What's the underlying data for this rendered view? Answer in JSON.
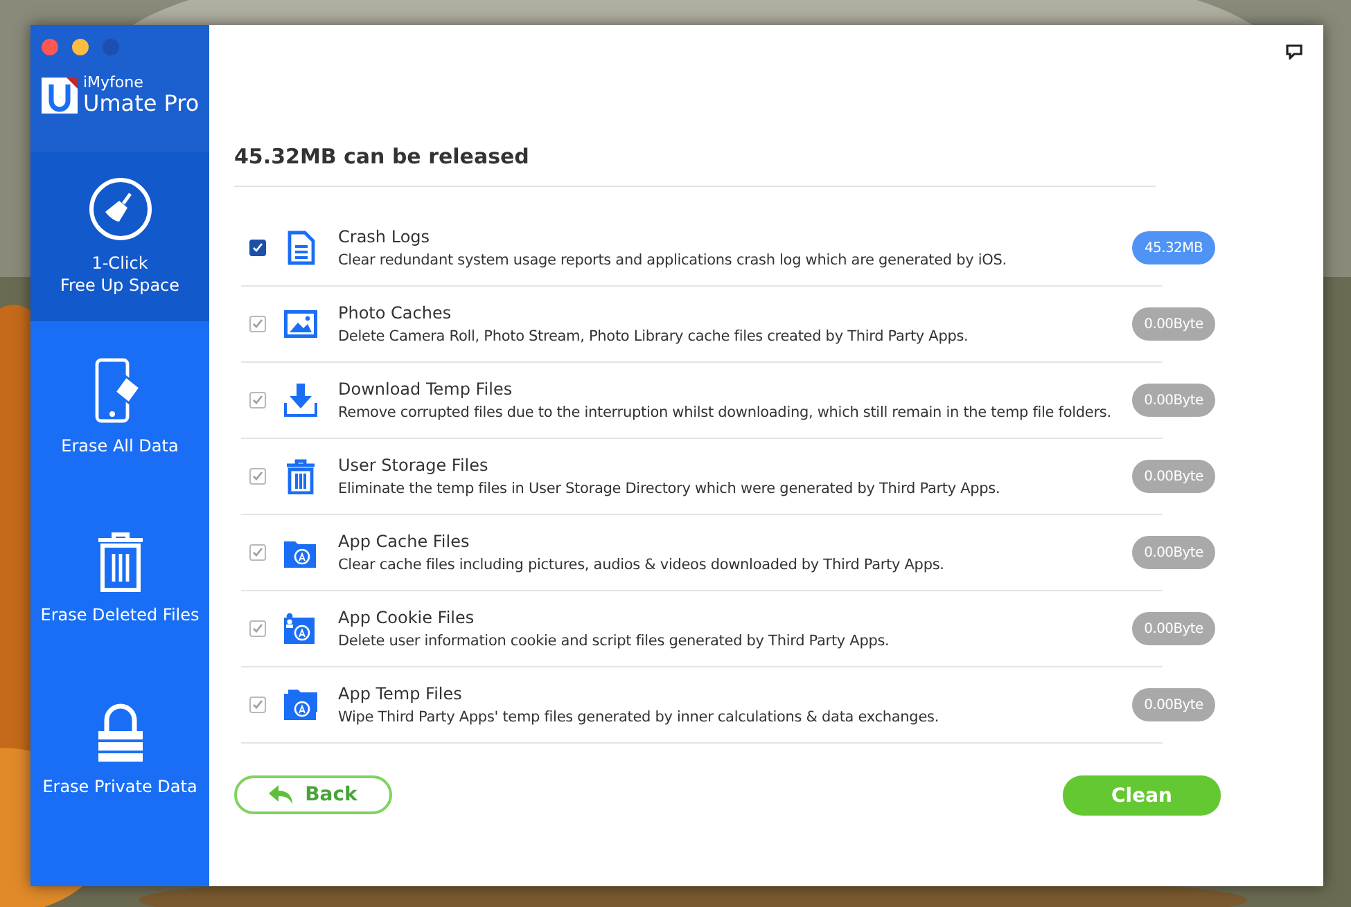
{
  "app": {
    "brand": "iMyfone",
    "product": "Umate Pro"
  },
  "sidebar": {
    "items": [
      {
        "kind": "broom",
        "label": "1-Click\nFree Up Space",
        "selected": true
      },
      {
        "kind": "phone",
        "label": "Erase All Data",
        "selected": false
      },
      {
        "kind": "trash",
        "label": "Erase Deleted Files",
        "selected": false
      },
      {
        "kind": "lock",
        "label": "Erase Private Data",
        "selected": false
      }
    ]
  },
  "heading": "45.32MB can be released",
  "rows": [
    {
      "kind": "document",
      "title": "Crash Logs",
      "description": "Clear redundant system usage reports and applications crash log which are generated by iOS.",
      "size": "45.32MB",
      "checked": true,
      "disabled": false
    },
    {
      "title": "Photo Caches",
      "description": "Delete Camera Roll, Photo Stream, Photo Library cache files created by Third Party Apps.",
      "size": "0.00Byte",
      "checked": true,
      "disabled": true
    },
    {
      "kind": "download",
      "title": "Download Temp Files",
      "description": "Remove corrupted files due to the interruption whilst downloading, which still remain in the temp file folders.",
      "size": "0.00Byte",
      "checked": true,
      "disabled": true
    },
    {
      "kind": "trash",
      "title": "User Storage Files",
      "description": "Eliminate the temp files in User Storage Directory which were generated by Third Party Apps.",
      "size": "0.00Byte",
      "checked": true,
      "disabled": true
    },
    {
      "kind": "app-folder",
      "title": "App Cache Files",
      "description": "Clear cache files including pictures, audios & videos downloaded by Third Party Apps.",
      "size": "0.00Byte",
      "checked": true,
      "disabled": true
    },
    {
      "kind": "app-folder-user",
      "title": "App Cookie Files",
      "description": "Delete user information cookie and script files generated by Third Party Apps.",
      "size": "0.00Byte",
      "checked": true,
      "disabled": true
    },
    {
      "kind": "app-folders",
      "title": "App Temp Files",
      "description": "Wipe Third Party Apps' temp files generated by inner calculations & data exchanges.",
      "size": "0.00Byte",
      "checked": true,
      "disabled": true
    }
  ],
  "buttons": {
    "back": "Back",
    "clean": "Clean"
  }
}
